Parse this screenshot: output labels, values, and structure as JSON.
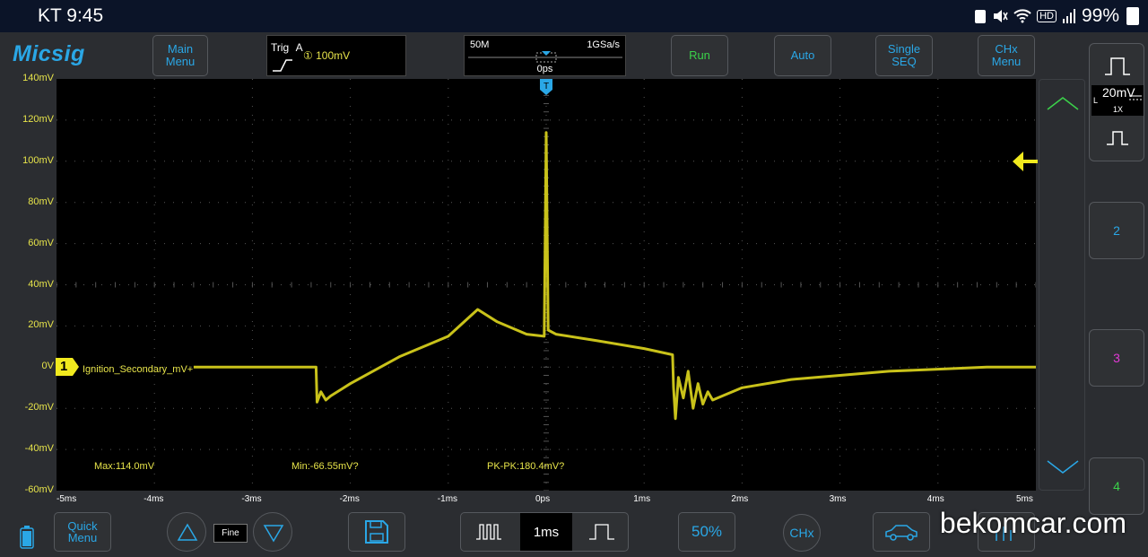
{
  "status_bar": {
    "carrier_time": "KT 9:45",
    "battery": "99%",
    "hd": "HD"
  },
  "header": {
    "logo": "Micsig",
    "main_menu": "Main\nMenu",
    "trigger": {
      "title": "Trig",
      "source": "A",
      "level": "① 100mV"
    },
    "timebase": {
      "memory": "50M",
      "sample_rate": "1GSa/s",
      "offset": "0ps"
    },
    "run": "Run",
    "auto": "Auto",
    "single_seq": "Single\nSEQ",
    "chx_menu": "CHx\nMenu"
  },
  "channel1": {
    "number": "1",
    "label": "Ignition_Secondary_mV+"
  },
  "measurements": {
    "max": "Max:114.0mV",
    "min": "Min:-66.55mV?",
    "pkpk": "PK-PK:180.4mV?"
  },
  "right_panel": {
    "scale": "20mV",
    "coupling": "L",
    "probe": "1X",
    "ch2": "2",
    "ch3": "3",
    "ch4": "4"
  },
  "bottom_bar": {
    "quick_menu": "Quick\nMenu",
    "fine": "Fine",
    "timebase": "1ms",
    "percent": "50%",
    "chx": "CHx"
  },
  "watermark": "bekomcar.com",
  "colors": {
    "trace": "#c9c21a",
    "accent": "#2aa7e6",
    "green": "#3bd14a"
  },
  "chart_data": {
    "type": "line",
    "y_tick_labels": [
      "140mV",
      "120mV",
      "100mV",
      "80mV",
      "60mV",
      "40mV",
      "20mV",
      "0V",
      "-20mV",
      "-40mV",
      "-60mV"
    ],
    "x_tick_labels": [
      "-5ms",
      "-4ms",
      "-3ms",
      "-2ms",
      "-1ms",
      "0ps",
      "1ms",
      "2ms",
      "3ms",
      "4ms",
      "5ms"
    ],
    "xlim": [
      -5,
      5
    ],
    "ylim": [
      -60,
      140
    ],
    "x_unit": "ms",
    "y_unit": "mV",
    "series": [
      {
        "x": [
          -3.6,
          -2.35,
          -2.34,
          -2.3,
          -2.25,
          -2.2,
          -2.0,
          -1.5,
          -1.0,
          -0.7,
          -0.5,
          -0.2,
          -0.02,
          0.0,
          0.02,
          0.1,
          0.5,
          1.0,
          1.29,
          1.3,
          1.32,
          1.35,
          1.4,
          1.45,
          1.5,
          1.55,
          1.6,
          1.65,
          1.7,
          1.8,
          2.0,
          2.5,
          3.0,
          3.5,
          4.0,
          4.5,
          5.0
        ],
        "y": [
          0,
          0,
          -17,
          -12,
          -16,
          -14,
          -8,
          5,
          15,
          28,
          22,
          16,
          15,
          114,
          18,
          16,
          13,
          9,
          6,
          -10,
          -25,
          -5,
          -15,
          -2,
          -20,
          -8,
          -18,
          -12,
          -16,
          -14,
          -10,
          -6,
          -4,
          -2,
          -1,
          0,
          0
        ]
      }
    ]
  }
}
